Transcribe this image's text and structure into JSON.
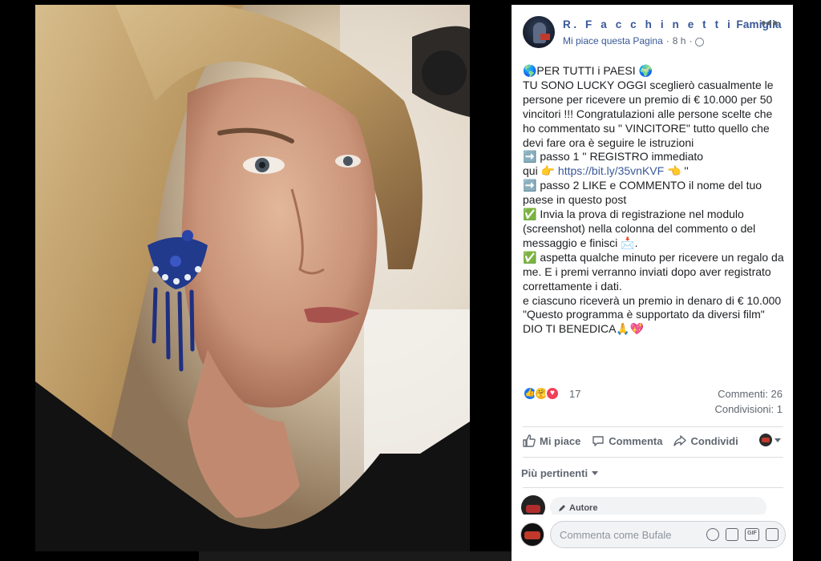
{
  "post": {
    "page_name_spaced": "R. F a c c h i n e t t i",
    "page_name_rest": "Famiglia",
    "like_page_label": "Mi piace questa Pagina",
    "separator": "·",
    "time": "8 h",
    "separator2": "·",
    "more_label": "•••",
    "body_lines": [
      "🌎PER TUTTI i PAESI 🌍",
      "TU SONO LUCKY OGGI sceglierò casualmente le persone per ricevere un premio di € 10.000 per 50 vincitori !!! Congratulazioni alle persone scelte che ho commentato su \" VINCITORE\" tutto quello che devi fare ora è seguire le istruzioni",
      "➡️ passo 1 '' REGISTRO immediato",
      "qui 👉 ",
      "➡️ passo 2 LIKE e COMMENTO il nome del tuo paese in questo post",
      "✅ Invia la prova di registrazione nel modulo (screenshot) nella colonna del commento o del messaggio e finisci 📩.",
      "✅ aspetta qualche minuto per ricevere un regalo da me. E i premi verranno inviati dopo aver registrato correttamente i dati.",
      "e ciascuno riceverà un premio in denaro di € 10.000",
      "\"Questo programma è supportato da diversi film\"",
      "DIO TI BENEDICA🙏💖"
    ],
    "link": "https://bit.ly/35vnKVF",
    "link_suffix": " 👈 ''"
  },
  "reactions": {
    "count": "17",
    "comments": "Commenti: 26",
    "shares": "Condivisioni: 1"
  },
  "actions": {
    "like": "Mi piace",
    "comment": "Commenta",
    "share": "Condividi"
  },
  "comments": {
    "sort_label": "Più pertinenti",
    "first_author_badge": "Autore",
    "compose_placeholder": "Commenta come Bufale"
  },
  "colors": {
    "brand_link": "#385898",
    "panel_bg": "#ffffff",
    "backdrop": "#000000"
  }
}
